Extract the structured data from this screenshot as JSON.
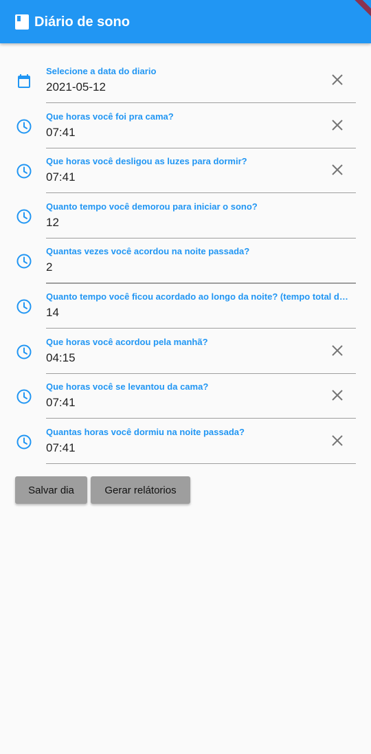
{
  "appbar": {
    "title": "Diário de sono",
    "icon": "book-icon"
  },
  "colors": {
    "primary": "#2196f3",
    "button": "#9e9e9e"
  },
  "fields": [
    {
      "label": "Selecione a data do diario",
      "value": "2021-05-12",
      "icon": "calendar-icon",
      "clearable": true
    },
    {
      "label": "Que horas você foi pra cama?",
      "value": "07:41",
      "icon": "clock-icon",
      "clearable": true
    },
    {
      "label": "Que horas você desligou as luzes para dormir?",
      "value": "07:41",
      "icon": "clock-icon",
      "clearable": true
    },
    {
      "label": "Quanto tempo você demorou para iniciar o sono?",
      "value": "12",
      "icon": "clock-icon",
      "clearable": false
    },
    {
      "label": "Quantas vezes você acordou na noite passada?",
      "value": "2",
      "icon": "clock-icon",
      "clearable": false
    },
    {
      "label": "Quanto tempo você ficou acordado ao longo da noite? (tempo total dos ...",
      "value": "14",
      "icon": "clock-icon",
      "clearable": false
    },
    {
      "label": "Que horas você acordou pela manhã?",
      "value": "04:15",
      "icon": "clock-icon",
      "clearable": true
    },
    {
      "label": "Que horas você se levantou da cama?",
      "value": "07:41",
      "icon": "clock-icon",
      "clearable": true
    },
    {
      "label": "Quantas horas você dormiu na noite passada?",
      "value": "07:41",
      "icon": "clock-icon",
      "clearable": true
    }
  ],
  "buttons": {
    "save_label": "Salvar dia",
    "reports_label": "Gerar relátorios"
  }
}
